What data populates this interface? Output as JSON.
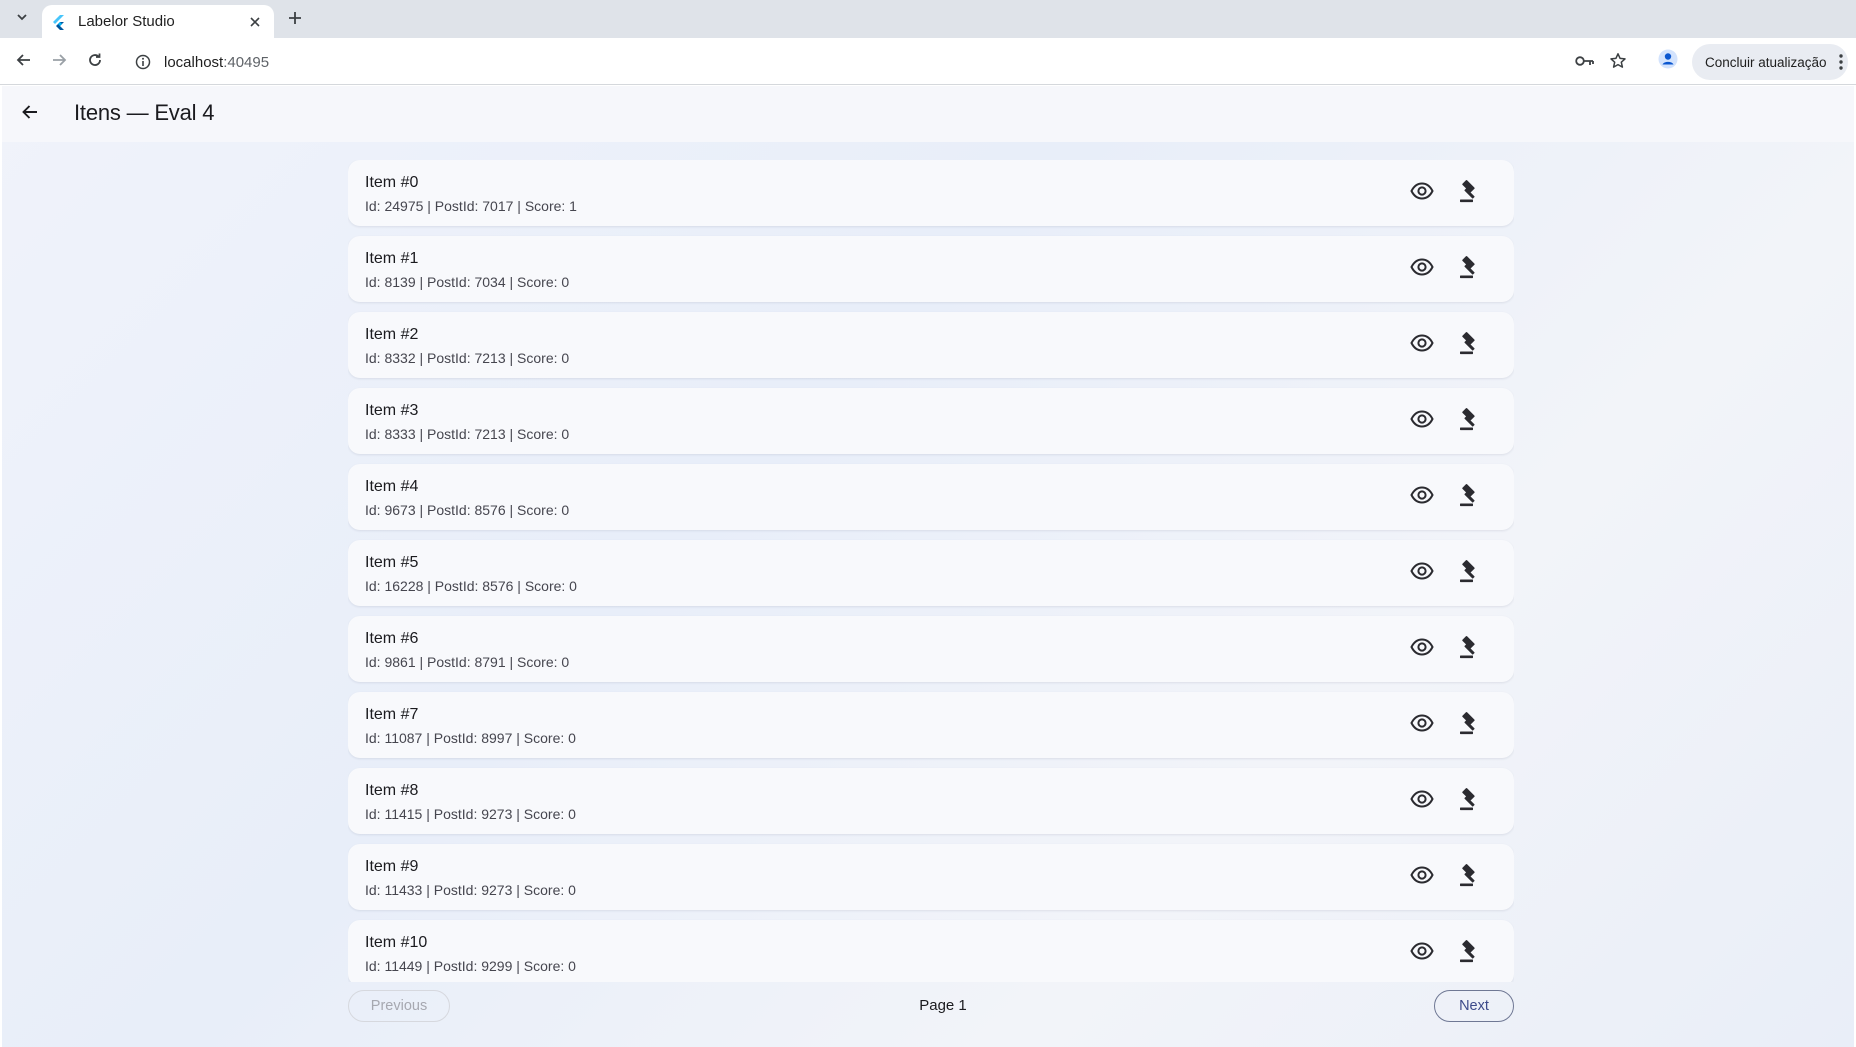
{
  "browser": {
    "tab": {
      "title": "Labelor Studio"
    },
    "address": {
      "host": "localhost",
      "port": ":40495"
    },
    "update_button": "Concluir atualização",
    "icons": {
      "tab_search": "chevron-down-icon",
      "new_tab": "plus-icon",
      "back": "arrow-left-icon",
      "forward": "arrow-right-icon",
      "reload": "reload-icon",
      "site_info": "info-icon",
      "password": "key-icon",
      "bookmark": "star-icon",
      "profile": "person-icon",
      "menu": "kebab-icon"
    }
  },
  "app": {
    "title": "Itens — Eval 4",
    "accent": "#3d4a8a",
    "items": [
      {
        "title": "Item #0",
        "subtitle": "Id: 24975 | PostId: 7017 | Score: 1"
      },
      {
        "title": "Item #1",
        "subtitle": "Id: 8139 | PostId: 7034 | Score: 0"
      },
      {
        "title": "Item #2",
        "subtitle": "Id: 8332 | PostId: 7213 | Score: 0"
      },
      {
        "title": "Item #3",
        "subtitle": "Id: 8333 | PostId: 7213 | Score: 0"
      },
      {
        "title": "Item #4",
        "subtitle": "Id: 9673 | PostId: 8576 | Score: 0"
      },
      {
        "title": "Item #5",
        "subtitle": "Id: 16228 | PostId: 8576 | Score: 0"
      },
      {
        "title": "Item #6",
        "subtitle": "Id: 9861 | PostId: 8791 | Score: 0"
      },
      {
        "title": "Item #7",
        "subtitle": "Id: 11087 | PostId: 8997 | Score: 0"
      },
      {
        "title": "Item #8",
        "subtitle": "Id: 11415 | PostId: 9273 | Score: 0"
      },
      {
        "title": "Item #9",
        "subtitle": "Id: 11433 | PostId: 9273 | Score: 0"
      },
      {
        "title": "Item #10",
        "subtitle": "Id: 11449 | PostId: 9299 | Score: 0"
      }
    ],
    "item_icons": {
      "view": "eye-icon",
      "judge": "gavel-icon"
    },
    "pagination": {
      "previous": "Previous",
      "page": "Page 1",
      "next": "Next"
    }
  }
}
